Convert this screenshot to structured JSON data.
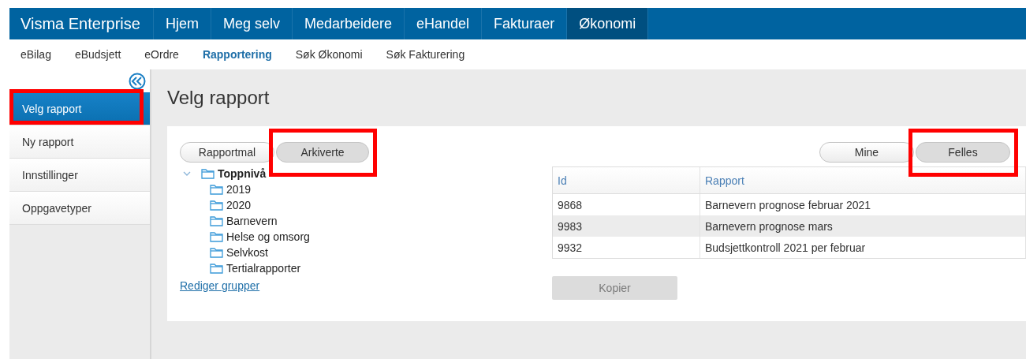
{
  "top_nav": {
    "brand": "Visma Enterprise",
    "items": [
      {
        "label": "Hjem",
        "selected": false
      },
      {
        "label": "Meg selv",
        "selected": false
      },
      {
        "label": "Medarbeidere",
        "selected": false
      },
      {
        "label": "eHandel",
        "selected": false
      },
      {
        "label": "Fakturaer",
        "selected": false
      },
      {
        "label": "Økonomi",
        "selected": true
      }
    ]
  },
  "sub_nav": [
    {
      "label": "eBilag",
      "selected": false
    },
    {
      "label": "eBudsjett",
      "selected": false
    },
    {
      "label": "eOrdre",
      "selected": false
    },
    {
      "label": "Rapportering",
      "selected": true
    },
    {
      "label": "Søk Økonomi",
      "selected": false
    },
    {
      "label": "Søk Fakturering",
      "selected": false
    }
  ],
  "sidebar": {
    "items": [
      {
        "label": "Velg rapport",
        "selected": true,
        "annotated": true
      },
      {
        "label": "Ny rapport",
        "selected": false,
        "annotated": false
      },
      {
        "label": "Innstillinger",
        "selected": false,
        "annotated": false
      },
      {
        "label": "Oppgavetyper",
        "selected": false,
        "annotated": false
      }
    ]
  },
  "page_title": "Velg rapport",
  "left_toggle": [
    {
      "label": "Rapportmal",
      "selected": false,
      "annotated": false
    },
    {
      "label": "Arkiverte",
      "selected": true,
      "annotated": true
    }
  ],
  "tree": {
    "label": "Toppnivå",
    "expanded": true,
    "children": [
      {
        "label": "2019"
      },
      {
        "label": "2020"
      },
      {
        "label": "Barnevern"
      },
      {
        "label": "Helse og omsorg"
      },
      {
        "label": "Selvkost"
      },
      {
        "label": "Tertialrapporter"
      }
    ]
  },
  "edit_groups_link": "Rediger grupper",
  "right_toggle": [
    {
      "label": "Mine",
      "selected": false,
      "annotated": false
    },
    {
      "label": "Felles",
      "selected": true,
      "annotated": true
    }
  ],
  "table": {
    "columns": [
      "Id",
      "Rapport"
    ],
    "rows": [
      [
        "9868",
        "Barnevern prognose februar 2021"
      ],
      [
        "9983",
        "Barnevern prognose mars"
      ],
      [
        "9932",
        "Budsjettkontroll 2021 per februar"
      ]
    ]
  },
  "copy_button": {
    "label": "Kopier",
    "disabled": true
  }
}
